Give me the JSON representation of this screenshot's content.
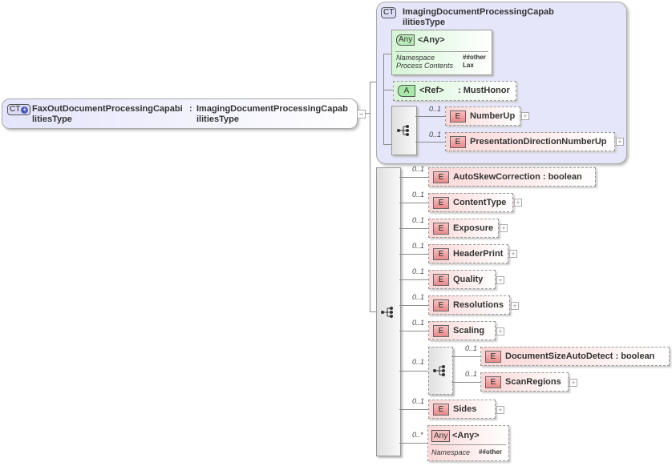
{
  "root": {
    "badge": "CT",
    "name": "FaxOutDocumentProcessingCapabilitiesType",
    "name_line1": "FaxOutDocumentProcessingCapabi",
    "name_line2": "litiesType",
    "separator": ":",
    "type_line1": "ImagingDocumentProcessingCapab",
    "type_line2": "ilitiesType",
    "icon": "complex-type-plus-icon"
  },
  "base_type": {
    "badge": "CT",
    "name_line1": "ImagingDocumentProcessingCapab",
    "name_line2": "ilitiesType",
    "any": {
      "badge": "Any",
      "label": "<Any>",
      "props": [
        {
          "key": "Namespace",
          "value": "##other"
        },
        {
          "key": "Process Contents",
          "value": "Lax"
        }
      ]
    },
    "attribute": {
      "badge": "A",
      "label": "<Ref>",
      "type": ": MustHonor"
    },
    "sequence": {
      "icon": "sequence-icon",
      "elements": [
        {
          "occurrence": "0..1",
          "badge": "E",
          "name": "NumberUp",
          "expandable": true
        },
        {
          "occurrence": "0..1",
          "badge": "E",
          "name": "PresentationDirectionNumberUp",
          "expandable": true
        }
      ]
    }
  },
  "sequence": {
    "icon": "sequence-icon",
    "elements": [
      {
        "occurrence": "0..1",
        "badge": "E",
        "name": "AutoSkewCorrection : boolean",
        "expandable": false
      },
      {
        "occurrence": "0..1",
        "badge": "E",
        "name": "ContentType",
        "expandable": true
      },
      {
        "occurrence": "0..1",
        "badge": "E",
        "name": "Exposure",
        "expandable": true
      },
      {
        "occurrence": "0..1",
        "badge": "E",
        "name": "HeaderPrint",
        "expandable": true
      },
      {
        "occurrence": "0..1",
        "badge": "E",
        "name": "Quality",
        "expandable": true
      },
      {
        "occurrence": "0..1",
        "badge": "E",
        "name": "Resolutions",
        "expandable": true
      },
      {
        "occurrence": "0..1",
        "badge": "E",
        "name": "Scaling",
        "expandable": true
      }
    ],
    "nested_sequence": {
      "occurrence": "0..1",
      "elements": [
        {
          "occurrence": "0..1",
          "badge": "E",
          "name": "DocumentSizeAutoDetect : boolean",
          "expandable": false
        },
        {
          "occurrence": "0..1",
          "badge": "E",
          "name": "ScanRegions",
          "expandable": true
        }
      ]
    },
    "sides": {
      "occurrence": "0..1",
      "badge": "E",
      "name": "Sides",
      "expandable": true
    },
    "any": {
      "occurrence": "0..*",
      "badge": "Any",
      "label": "<Any>",
      "props": [
        {
          "key": "Namespace",
          "value": "##other"
        }
      ]
    }
  }
}
